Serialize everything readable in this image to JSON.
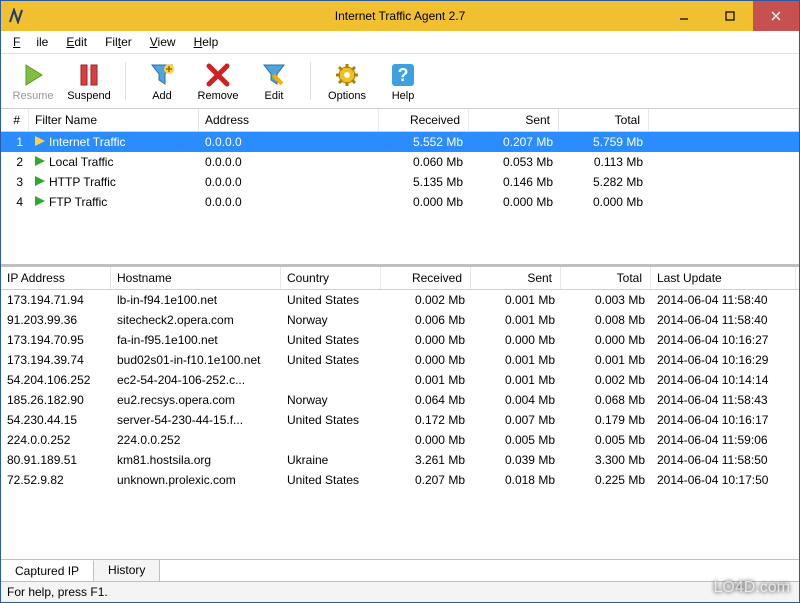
{
  "window": {
    "title": "Internet Traffic Agent 2.7"
  },
  "menu": {
    "items": [
      "File",
      "Edit",
      "Filter",
      "View",
      "Help"
    ]
  },
  "toolbar": {
    "resume": "Resume",
    "suspend": "Suspend",
    "add": "Add",
    "remove": "Remove",
    "edit": "Edit",
    "options": "Options",
    "help": "Help"
  },
  "filters": {
    "columns": [
      "#",
      "Filter Name",
      "Address",
      "Received",
      "Sent",
      "Total"
    ],
    "rows": [
      {
        "num": "1",
        "name": "Internet Traffic",
        "addr": "0.0.0.0",
        "recv": "5.552 Mb",
        "sent": "0.207 Mb",
        "total": "5.759 Mb",
        "selected": true,
        "playing": false
      },
      {
        "num": "2",
        "name": "Local Traffic",
        "addr": "0.0.0.0",
        "recv": "0.060 Mb",
        "sent": "0.053 Mb",
        "total": "0.113 Mb",
        "selected": false,
        "playing": true
      },
      {
        "num": "3",
        "name": "HTTP Traffic",
        "addr": "0.0.0.0",
        "recv": "5.135 Mb",
        "sent": "0.146 Mb",
        "total": "5.282 Mb",
        "selected": false,
        "playing": true
      },
      {
        "num": "4",
        "name": "FTP Traffic",
        "addr": "0.0.0.0",
        "recv": "0.000 Mb",
        "sent": "0.000 Mb",
        "total": "0.000 Mb",
        "selected": false,
        "playing": true
      }
    ]
  },
  "captured": {
    "columns": [
      "IP Address",
      "Hostname",
      "Country",
      "Received",
      "Sent",
      "Total",
      "Last Update"
    ],
    "rows": [
      {
        "ip": "173.194.71.94",
        "host": "lb-in-f94.1e100.net",
        "country": "United States",
        "recv": "0.002 Mb",
        "sent": "0.001 Mb",
        "total": "0.003 Mb",
        "time": "2014-06-04  11:58:40"
      },
      {
        "ip": "91.203.99.36",
        "host": "sitecheck2.opera.com",
        "country": "Norway",
        "recv": "0.006 Mb",
        "sent": "0.001 Mb",
        "total": "0.008 Mb",
        "time": "2014-06-04  11:58:40"
      },
      {
        "ip": "173.194.70.95",
        "host": "fa-in-f95.1e100.net",
        "country": "United States",
        "recv": "0.000 Mb",
        "sent": "0.000 Mb",
        "total": "0.000 Mb",
        "time": "2014-06-04  10:16:27"
      },
      {
        "ip": "173.194.39.74",
        "host": "bud02s01-in-f10.1e100.net",
        "country": "United States",
        "recv": "0.000 Mb",
        "sent": "0.001 Mb",
        "total": "0.001 Mb",
        "time": "2014-06-04  10:16:29"
      },
      {
        "ip": "54.204.106.252",
        "host": "ec2-54-204-106-252.c...",
        "country": "",
        "recv": "0.001 Mb",
        "sent": "0.001 Mb",
        "total": "0.002 Mb",
        "time": "2014-06-04  10:14:14"
      },
      {
        "ip": "185.26.182.90",
        "host": "eu2.recsys.opera.com",
        "country": "Norway",
        "recv": "0.064 Mb",
        "sent": "0.004 Mb",
        "total": "0.068 Mb",
        "time": "2014-06-04  11:58:43"
      },
      {
        "ip": "54.230.44.15",
        "host": "server-54-230-44-15.f...",
        "country": "United States",
        "recv": "0.172 Mb",
        "sent": "0.007 Mb",
        "total": "0.179 Mb",
        "time": "2014-06-04  10:16:17"
      },
      {
        "ip": "224.0.0.252",
        "host": "224.0.0.252",
        "country": "",
        "recv": "0.000 Mb",
        "sent": "0.005 Mb",
        "total": "0.005 Mb",
        "time": "2014-06-04  11:59:06"
      },
      {
        "ip": "80.91.189.51",
        "host": "km81.hostsila.org",
        "country": "Ukraine",
        "recv": "3.261 Mb",
        "sent": "0.039 Mb",
        "total": "3.300 Mb",
        "time": "2014-06-04  11:58:50"
      },
      {
        "ip": "72.52.9.82",
        "host": "unknown.prolexic.com",
        "country": "United States",
        "recv": "0.207 Mb",
        "sent": "0.018 Mb",
        "total": "0.225 Mb",
        "time": "2014-06-04  10:17:50"
      }
    ]
  },
  "tabs": {
    "captured": "Captured IP",
    "history": "History"
  },
  "status": {
    "text": "For help, press F1."
  },
  "watermark": "LO4D.com"
}
